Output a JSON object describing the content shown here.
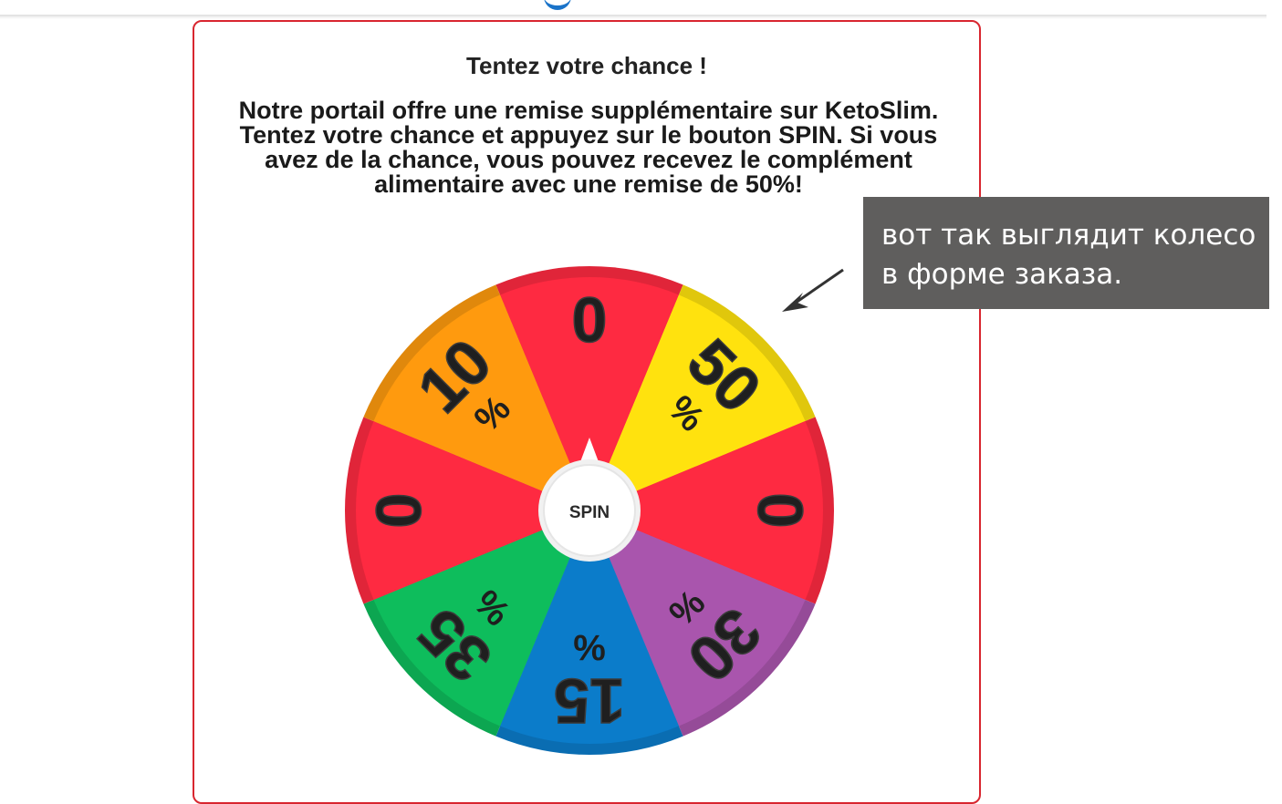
{
  "promo": {
    "title": "Tentez votre chance !",
    "description": "Notre portail offre une remise supplémentaire sur KetoSlim. Tentez votre chance et appuyez sur le bouton SPIN. Si vous avez de la chance, vous pouvez recevez le complément alimentaire avec une remise de 50%!"
  },
  "wheel": {
    "spin_label": "SPIN",
    "segments": [
      {
        "value": "0",
        "unit": "",
        "color": "#fe2a41"
      },
      {
        "value": "50",
        "unit": "%",
        "color": "#ffe20e"
      },
      {
        "value": "0",
        "unit": "",
        "color": "#fe2a41"
      },
      {
        "value": "30",
        "unit": "%",
        "color": "#a955ad"
      },
      {
        "value": "15",
        "unit": "%",
        "color": "#0b7cca"
      },
      {
        "value": "35",
        "unit": "%",
        "color": "#0ebd5c"
      },
      {
        "value": "0",
        "unit": "",
        "color": "#fe2a41"
      },
      {
        "value": "10",
        "unit": "%",
        "color": "#ff9a0e"
      }
    ]
  },
  "annotation": {
    "line1": "вот так выглядит колесо",
    "line2": "в форме заказа."
  },
  "colors": {
    "accent_border": "#d8262f",
    "note_background": "#5f5e5d"
  }
}
